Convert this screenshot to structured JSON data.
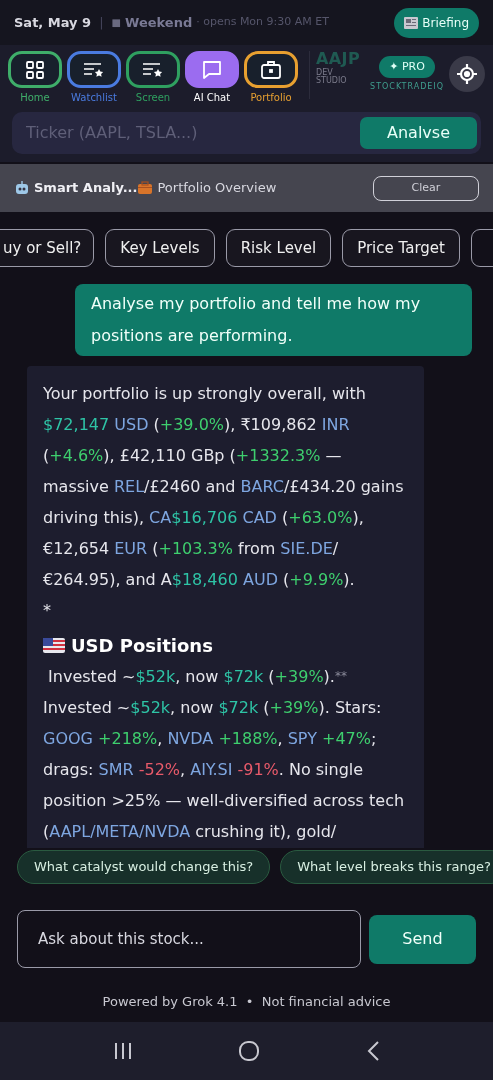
{
  "status_bar": {
    "date": "Sat, May 9",
    "separator": "|",
    "market_icon": "■",
    "market_state": "Weekend",
    "market_note": "· opens Mon 9:30 AM ET",
    "briefing_button": "Briefing"
  },
  "nav_tabs": [
    {
      "label": "Home",
      "color": "#3fae6a",
      "selected": false
    },
    {
      "label": "Watchlist",
      "color": "#4a7be0",
      "selected": false
    },
    {
      "label": "Screen",
      "color": "#2fa060",
      "selected": false
    },
    {
      "label": "AI Chat",
      "color": "#9b6cf0",
      "selected": true
    },
    {
      "label": "Portfolio",
      "color": "#e8a030",
      "selected": false
    }
  ],
  "logo": {
    "title": "AAJP",
    "line_1": "DEV",
    "line_2": "STUDIO"
  },
  "pro_badge": {
    "label": "✦ PRO",
    "brand": "STOCKTRADEIQ"
  },
  "ticker_search": {
    "placeholder": "Ticker (AAPL, TSLA...)",
    "button": "Analvse"
  },
  "context_bar": {
    "title": "Smart Analy...",
    "subtitle": "Portfolio Overview",
    "clear_button": "Clear"
  },
  "quick_prompts": [
    "uy or Sell?",
    "Key Levels",
    "Risk Level",
    "Price Target"
  ],
  "user_message": "Analyse my portfolio and tell me how my positions are performing.",
  "ai_message": [
    {
      "kind": "paragraph",
      "segments": [
        {
          "kind": "plain",
          "text": "Your portfolio is up strongly overall, with "
        },
        {
          "kind": "amount",
          "text": "$72,147"
        },
        {
          "kind": "ticker",
          "text": " USD"
        },
        {
          "kind": "plain",
          "text": " ("
        },
        {
          "kind": "gain",
          "text": "+39.0%"
        },
        {
          "kind": "plain",
          "text": "), ₹109,862 "
        },
        {
          "kind": "ticker",
          "text": "INR"
        },
        {
          "kind": "plain",
          "text": " ("
        },
        {
          "kind": "gain",
          "text": "+4.6%"
        },
        {
          "kind": "plain",
          "text": "), £42,110 GBp ("
        },
        {
          "kind": "gain",
          "text": "+1332.3%"
        },
        {
          "kind": "plain",
          "text": " — massive "
        },
        {
          "kind": "ticker",
          "text": "REL"
        },
        {
          "kind": "plain",
          "text": "/£2460 and "
        },
        {
          "kind": "ticker",
          "text": "BARC"
        },
        {
          "kind": "plain",
          "text": "/£434.20 gains driving this), "
        },
        {
          "kind": "ticker",
          "text": "CA"
        },
        {
          "kind": "amount",
          "text": "$16,706"
        },
        {
          "kind": "ticker",
          "text": " CAD"
        },
        {
          "kind": "plain",
          "text": " ("
        },
        {
          "kind": "gain",
          "text": "+63.0%"
        },
        {
          "kind": "plain",
          "text": "), €12,654 "
        },
        {
          "kind": "ticker",
          "text": "EUR"
        },
        {
          "kind": "plain",
          "text": " ("
        },
        {
          "kind": "gain",
          "text": "+103.3%"
        },
        {
          "kind": "plain",
          "text": " from "
        },
        {
          "kind": "ticker",
          "text": "SIE.DE"
        },
        {
          "kind": "plain",
          "text": "/€264.95), and A"
        },
        {
          "kind": "amount",
          "text": "$18,460"
        },
        {
          "kind": "ticker",
          "text": " AUD"
        },
        {
          "kind": "plain",
          "text": " ("
        },
        {
          "kind": "gain",
          "text": "+9.9%"
        },
        {
          "kind": "plain",
          "text": ")."
        }
      ]
    },
    {
      "kind": "paragraph",
      "segments": [
        {
          "kind": "plain",
          "text": "*"
        }
      ]
    },
    {
      "kind": "heading",
      "text": "USD Positions"
    },
    {
      "kind": "paragraph",
      "segments": [
        {
          "kind": "plain",
          "text": " Invested ~"
        },
        {
          "kind": "amount",
          "text": "$52k"
        },
        {
          "kind": "plain",
          "text": ", now "
        },
        {
          "kind": "amount",
          "text": "$72k"
        },
        {
          "kind": "plain",
          "text": " ("
        },
        {
          "kind": "gain",
          "text": "+39%"
        },
        {
          "kind": "plain",
          "text": ")."
        },
        {
          "kind": "faint",
          "text": "**"
        }
      ]
    },
    {
      "kind": "paragraph",
      "segments": [
        {
          "kind": "plain",
          "text": "Invested ~"
        },
        {
          "kind": "amount",
          "text": "$52k"
        },
        {
          "kind": "plain",
          "text": ", now "
        },
        {
          "kind": "amount",
          "text": "$72k"
        },
        {
          "kind": "plain",
          "text": " ("
        },
        {
          "kind": "gain",
          "text": "+39%"
        },
        {
          "kind": "plain",
          "text": "). Stars: "
        },
        {
          "kind": "ticker",
          "text": "GOOG"
        },
        {
          "kind": "gain",
          "text": " +218%"
        },
        {
          "kind": "plain",
          "text": ", "
        },
        {
          "kind": "ticker",
          "text": "NVDA"
        },
        {
          "kind": "gain",
          "text": " +188%"
        },
        {
          "kind": "plain",
          "text": ", "
        },
        {
          "kind": "ticker",
          "text": "SPY"
        },
        {
          "kind": "gain",
          "text": " +47%"
        },
        {
          "kind": "plain",
          "text": "; drags: "
        },
        {
          "kind": "ticker",
          "text": "SMR"
        },
        {
          "kind": "loss",
          "text": " -52%"
        },
        {
          "kind": "plain",
          "text": ", "
        },
        {
          "kind": "ticker",
          "text": "AIY.SI"
        },
        {
          "kind": "loss",
          "text": " -91%"
        },
        {
          "kind": "plain",
          "text": ". No single position >25% — well-diversified across tech ("
        },
        {
          "kind": "ticker",
          "text": "AAPL/META/NVDA"
        },
        {
          "kind": "plain",
          "text": " crushing it), gold/"
        }
      ]
    }
  ],
  "follow_ups": [
    "What catalyst would change this?",
    "What level breaks this range?"
  ],
  "chat_input": {
    "placeholder": "Ask about this stock...",
    "button": "Send"
  },
  "footer": "Powered by Grok 4.1  •  Not financial advice"
}
